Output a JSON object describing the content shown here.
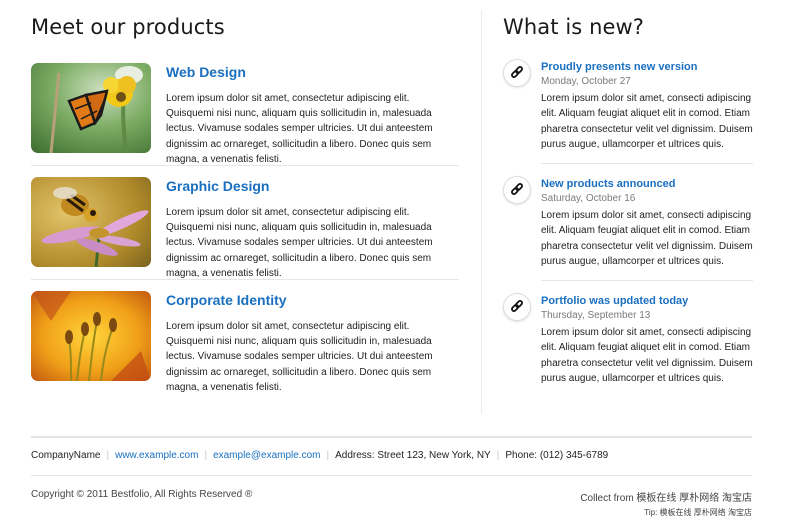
{
  "products_section": {
    "title": "Meet our products",
    "items": [
      {
        "title": "Web Design",
        "image": "butterfly-on-yellow-flower",
        "description": "Lorem ipsum dolor sit amet, consectetur adipiscing elit. Quisquemi nisi nunc, aliquam quis sollicitudin in, malesuada lectus. Vivamuse sodales semper ultricies. Ut dui anteestem dignissim ac ornareget, sollicitudin a libero. Donec quis sem magna, a venenatis felisti."
      },
      {
        "title": "Graphic Design",
        "image": "bee-on-pink-flower",
        "description": "Lorem ipsum dolor sit amet, consectetur adipiscing elit. Quisquemi nisi nunc, aliquam quis sollicitudin in, malesuada lectus. Vivamuse sodales semper ultricies. Ut dui anteestem dignissim ac ornareget, sollicitudin a libero. Donec quis sem magna, a venenatis felisti."
      },
      {
        "title": "Corporate Identity",
        "image": "lily-stamens-closeup",
        "description": "Lorem ipsum dolor sit amet, consectetur adipiscing elit. Quisquemi nisi nunc, aliquam quis sollicitudin in, malesuada lectus. Vivamuse sodales semper ultricies. Ut dui anteestem dignissim ac ornareget, sollicitudin a libero. Donec quis sem magna, a venenatis felisti."
      }
    ]
  },
  "news_section": {
    "title": "What is new?",
    "items": [
      {
        "icon": "link-icon",
        "title": "Proudly presents new version",
        "date": "Monday, October 27",
        "description": "Lorem ipsum dolor sit amet, consecti adipiscing elit. Aliquam feugiat aliquet elit in comod. Etiam pharetra consectetur velit vel dignissim. Duisem purus augue, ullamcorper et ultrices quis."
      },
      {
        "icon": "link-icon",
        "title": "New products announced",
        "date": "Saturday, October 16",
        "description": "Lorem ipsum dolor sit amet, consecti adipiscing elit. Aliquam feugiat aliquet elit in comod. Etiam pharetra consectetur velit vel dignissim. Duisem purus augue, ullamcorper et ultrices quis."
      },
      {
        "icon": "link-icon",
        "title": "Portfolio was updated today",
        "date": "Thursday, September 13",
        "description": "Lorem ipsum dolor sit amet, consecti adipiscing elit. Aliquam feugiat aliquet elit in comod. Etiam pharetra consectetur velit vel dignissim. Duisem purus augue, ullamcorper et ultrices quis."
      }
    ]
  },
  "footer": {
    "company_name": "CompanyName",
    "website": "www.example.com",
    "email": "example@example.com",
    "address": "Address: Street 123, New York, NY",
    "phone": "Phone: (012) 345-6789",
    "copyright": "Copyright © 2011 Bestfolio, All Rights Reserved ®",
    "collect_from": "Collect from 模板在线 厚朴网络 淘宝店",
    "tip": "Tip: 模板在线 厚朴网络 淘宝店"
  },
  "colors": {
    "link": "#1a6fc0",
    "text": "#222222",
    "muted": "#7a7a7a",
    "divider": "#e6e6e6"
  }
}
